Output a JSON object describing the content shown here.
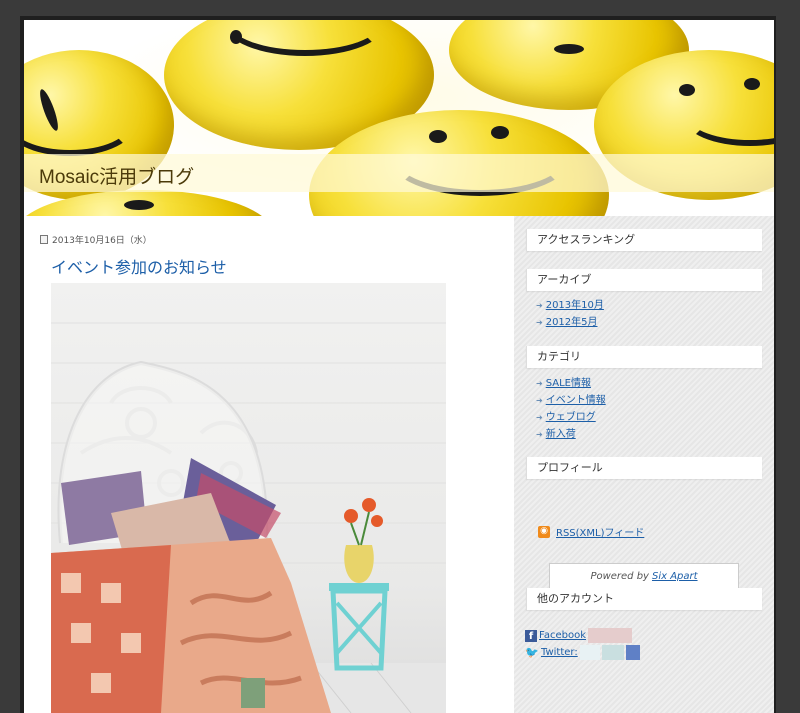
{
  "site": {
    "title": "Mosaic活用ブログ"
  },
  "post": {
    "date": "2013年10月16日（水）",
    "title": "イベント参加のお知らせ"
  },
  "sidebar": {
    "ranking_title": "アクセスランキング",
    "archive_title": "アーカイブ",
    "archive_items": [
      "2013年10月",
      "2012年5月"
    ],
    "category_title": "カテゴリ",
    "category_items": [
      "SALE情報",
      "イベント情報",
      "ウェブログ",
      "新入荷"
    ],
    "profile_title": "プロフィール",
    "rss_label": "RSS(XML)フィード",
    "powered_prefix": "Powered by",
    "powered_link": "Six Apart",
    "accounts_title": "他のアカウント",
    "facebook_label": "Facebook",
    "twitter_label": "Twitter:"
  },
  "colors": {
    "link": "#1d5fa8",
    "title_text": "#4b3a0a",
    "rss": "#f08a1a",
    "facebook": "#3b5a99",
    "twitter": "#4aa3df"
  },
  "icons": [
    "document-icon",
    "rss-icon",
    "facebook-icon",
    "twitter-icon",
    "bullet-icon"
  ]
}
